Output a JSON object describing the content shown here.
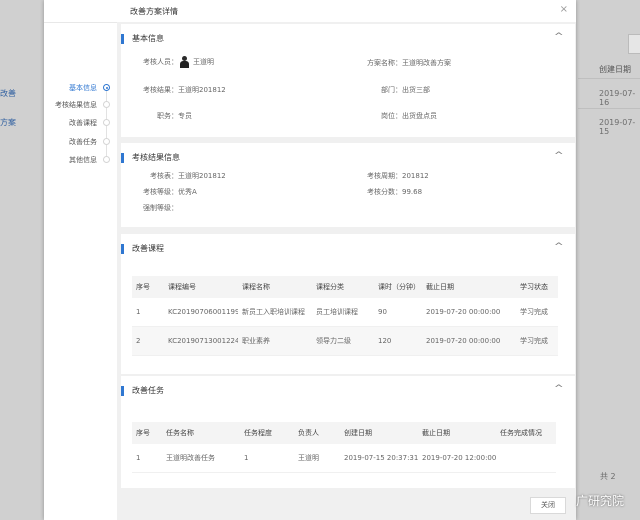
{
  "background": {
    "left_items": [
      "改善",
      "方案"
    ],
    "col_header": "创建日期",
    "dates": [
      "2019-07-16",
      "2019-07-15"
    ],
    "bottom_fragment": "共 2"
  },
  "modal": {
    "title": "改善方案详情",
    "close_label": "×",
    "close_button_label": "关闭"
  },
  "nav": {
    "items": [
      "基本信息",
      "考核结果信息",
      "改善课程",
      "改善任务",
      "其他信息"
    ]
  },
  "basic_info": {
    "title": "基本信息",
    "assessee_label": "考核人员：",
    "assessee_value": "王道明",
    "plan_name": "方案名称：王道明改善方案",
    "result": "考核结果：王道明201812",
    "department": "部门：出货三部",
    "position": "职务：专员",
    "post": "岗位：出货盘点员"
  },
  "result_info": {
    "title": "考核结果信息",
    "table": "考核表：王道明201812",
    "period": "考核周期：201812",
    "grade": "考核等级：优秀A",
    "score": "考核分数：99.68",
    "forced_grade": "强制等级："
  },
  "courses": {
    "title": "改善课程",
    "headers": [
      "序号",
      "课程编号",
      "课程名称",
      "课程分类",
      "课时（分钟）",
      "截止日期",
      "学习状态"
    ],
    "rows": [
      [
        "1",
        "KC20190706001199",
        "新员工入职培训课程",
        "员工培训课程",
        "90",
        "2019-07-20 00:00:00",
        "学习完成"
      ],
      [
        "2",
        "KC20190713001224",
        "职业素养",
        "领导力二级",
        "120",
        "2019-07-20 00:00:00",
        "学习完成"
      ]
    ]
  },
  "tasks": {
    "title": "改善任务",
    "headers": [
      "序号",
      "任务名称",
      "任务程度",
      "负责人",
      "创建日期",
      "截止日期",
      "任务完成情况"
    ],
    "rows": [
      [
        "1",
        "王道明改善任务",
        "1",
        "王道明",
        "2019-07-15 20:37:31",
        "2019-07-20 12:00:00",
        ""
      ]
    ]
  },
  "watermark": "广研究院",
  "colors": {
    "accent": "#2f77d1"
  }
}
